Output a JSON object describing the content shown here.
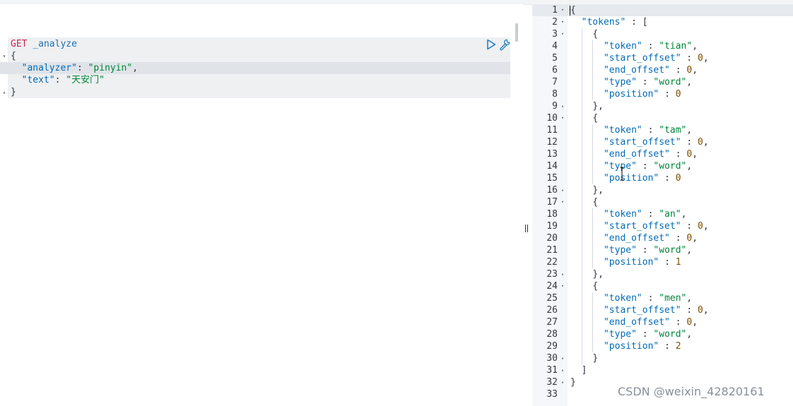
{
  "request": {
    "method": "GET",
    "path": "_analyze",
    "open_brace": "{",
    "analyzer_key": "\"analyzer\"",
    "analyzer_value": "\"pinyin\"",
    "text_key": "\"text\"",
    "text_value": "\"天安门\"",
    "close_brace": "}"
  },
  "icons": {
    "run": "play-icon",
    "settings": "wrench-icon",
    "resizer": "resize-handle-icon"
  },
  "response": {
    "line_numbers": [
      "1",
      "2",
      "3",
      "4",
      "5",
      "6",
      "7",
      "8",
      "9",
      "10",
      "11",
      "12",
      "13",
      "14",
      "15",
      "16",
      "17",
      "18",
      "19",
      "20",
      "21",
      "22",
      "23",
      "24",
      "25",
      "26",
      "27",
      "28",
      "29",
      "30",
      "31",
      "32",
      "33"
    ],
    "fold_markers": [
      "▾",
      "▾",
      "▾",
      "",
      "",
      "",
      "",
      "",
      "▴",
      "▾",
      "",
      "",
      "",
      "",
      "",
      "▴",
      "▾",
      "",
      "",
      "",
      "",
      "",
      "▴",
      "▾",
      "",
      "",
      "",
      "",
      "",
      "▴",
      "▴",
      "▴",
      ""
    ],
    "open_brace": "{",
    "tokens_key": "\"tokens\"",
    "open_bracket": "[",
    "close_bracket": "]",
    "close_brace": "}",
    "token_label": "\"token\"",
    "start_offset_label": "\"start_offset\"",
    "end_offset_label": "\"end_offset\"",
    "type_label": "\"type\"",
    "position_label": "\"position\"",
    "tokens": [
      {
        "token": "\"tian\"",
        "start_offset": "0",
        "end_offset": "0",
        "type": "\"word\"",
        "position": "0"
      },
      {
        "token": "\"tam\"",
        "start_offset": "0",
        "end_offset": "0",
        "type": "\"word\"",
        "position": "0"
      },
      {
        "token": "\"an\"",
        "start_offset": "0",
        "end_offset": "0",
        "type": "\"word\"",
        "position": "1"
      },
      {
        "token": "\"men\"",
        "start_offset": "0",
        "end_offset": "0",
        "type": "\"word\"",
        "position": "2"
      }
    ]
  },
  "watermark": "CSDN @weixin_42820161"
}
